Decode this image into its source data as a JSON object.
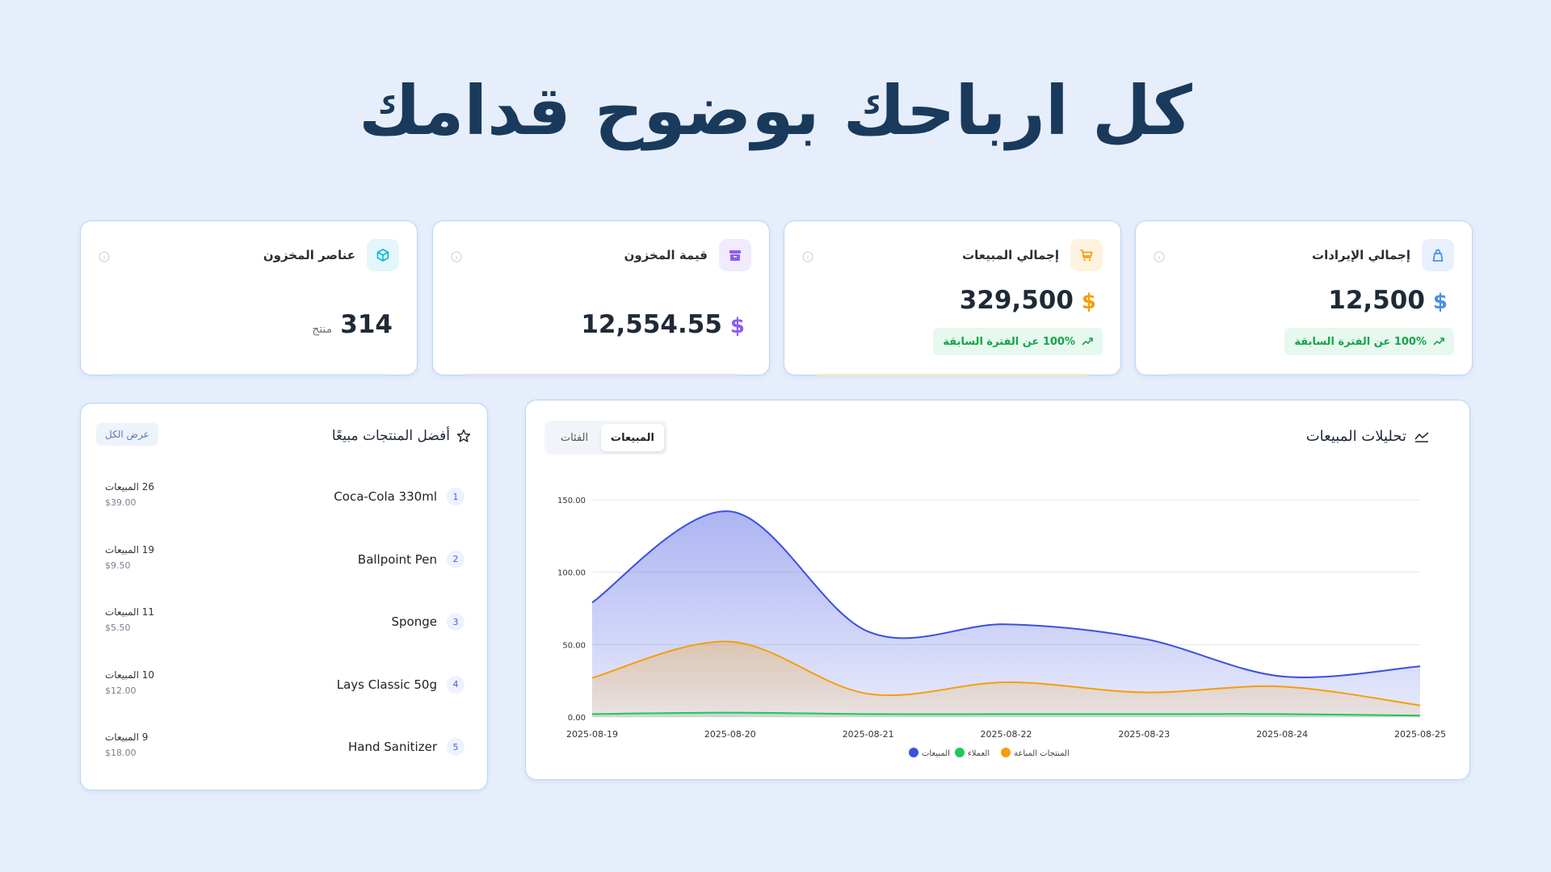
{
  "headline": "كل ارباحك بوضوح قدامك",
  "stats": [
    {
      "title": "إجمالي الإيرادات",
      "value": "12,500",
      "unit": "$",
      "trend": "100% عن الفترة السابقة",
      "icon": "bag-icon",
      "color": "#4a90e2",
      "bg": "#e8f0fd"
    },
    {
      "title": "إجمالي المبيعات",
      "value": "329,500",
      "unit": "$",
      "trend": "100% عن الفترة السابقة",
      "icon": "cart-icon",
      "color": "#f59e0b",
      "bg": "#fff3e0"
    },
    {
      "title": "قيمة المخزون",
      "value": "12,554.55",
      "unit": "$",
      "icon": "archive-icon",
      "color": "#8b5cf6",
      "bg": "#f1ebfd"
    },
    {
      "title": "عناصر المخزون",
      "value": "314",
      "unit": "منتج",
      "icon": "box-icon",
      "color": "#06b6d4",
      "bg": "#e3f6fa"
    }
  ],
  "top_products": {
    "title": "أفضل المنتجات مبيعًا",
    "view_all": "عرض الكل",
    "items": [
      {
        "rank": "1",
        "name": "Coca-Cola 330ml",
        "sales": "26 المبيعات",
        "price": "$39.00"
      },
      {
        "rank": "2",
        "name": "Ballpoint Pen",
        "sales": "19 المبيعات",
        "price": "$9.50"
      },
      {
        "rank": "3",
        "name": "Sponge",
        "sales": "11 المبيعات",
        "price": "$5.50"
      },
      {
        "rank": "4",
        "name": "Lays Classic 50g",
        "sales": "10 المبيعات",
        "price": "$12.00"
      },
      {
        "rank": "5",
        "name": "Hand Sanitizer",
        "sales": "9 المبيعات",
        "price": "$18.00"
      }
    ]
  },
  "analytics": {
    "title": "تحليلات المبيعات",
    "tabs": [
      "المبيعات",
      "الفئات"
    ],
    "active_tab": "المبيعات"
  },
  "chart_data": {
    "type": "area",
    "x": [
      "2025-08-19",
      "2025-08-20",
      "2025-08-21",
      "2025-08-22",
      "2025-08-23",
      "2025-08-24",
      "2025-08-25"
    ],
    "ylim": [
      0,
      150
    ],
    "yticks": [
      "0.00",
      "50.00",
      "100.00",
      "150.00"
    ],
    "grid": true,
    "legend_position": "bottom-center",
    "series": [
      {
        "name": "المبيعات",
        "color": "#3b4fe0",
        "values": [
          79,
          142,
          59,
          64,
          54,
          28,
          35
        ]
      },
      {
        "name": "العملاء",
        "color": "#22c55e",
        "values": [
          2,
          3,
          2,
          2,
          2,
          2,
          1
        ]
      },
      {
        "name": "المنتجات المباعة",
        "color": "#f59e0b",
        "values": [
          27,
          52,
          16,
          24,
          17,
          21,
          8
        ]
      }
    ]
  }
}
